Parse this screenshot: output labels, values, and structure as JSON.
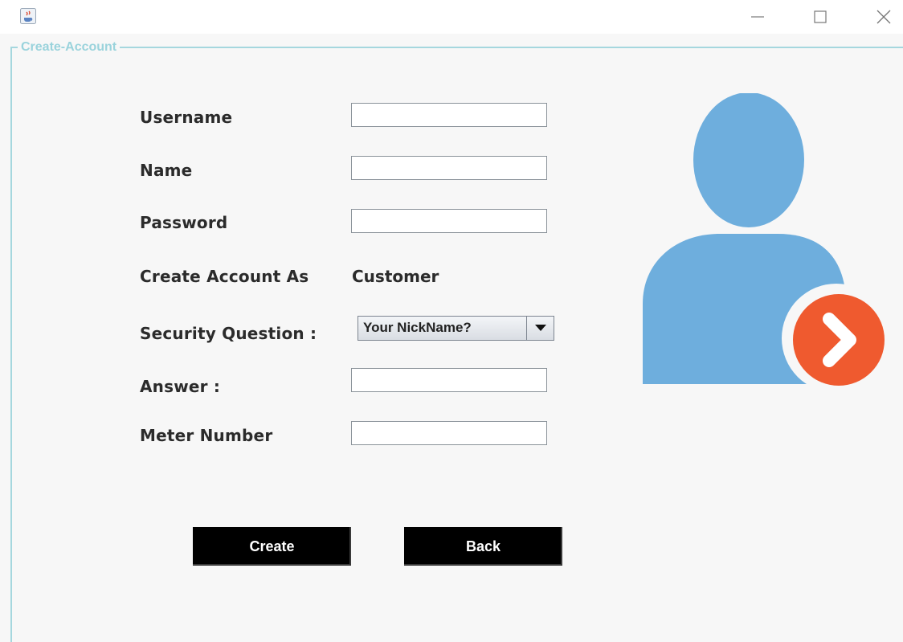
{
  "window": {
    "icons": {
      "app": "java-cup-icon",
      "minimize": "minimize-icon",
      "maximize": "maximize-icon",
      "close": "close-icon"
    }
  },
  "panel": {
    "title": "Create-Account"
  },
  "form": {
    "username_label": "Username",
    "username_value": "",
    "name_label": "Name",
    "name_value": "",
    "password_label": "Password",
    "password_value": "",
    "account_type_label": "Create Account As",
    "account_type_value": "Customer",
    "security_question_label": "Security Question :",
    "security_question_selected": "Your NickName?",
    "answer_label": "Answer :",
    "answer_value": "",
    "meter_number_label": "Meter Number",
    "meter_number_value": ""
  },
  "actions": {
    "create_label": "Create",
    "back_label": "Back"
  },
  "illustration": {
    "icon": "user-arrow-icon",
    "person_color": "#6eaedd",
    "badge_color": "#ef5a2f"
  },
  "colors": {
    "panel_border": "#a5d7de",
    "button_bg": "#000000",
    "button_text": "#ffffff"
  }
}
